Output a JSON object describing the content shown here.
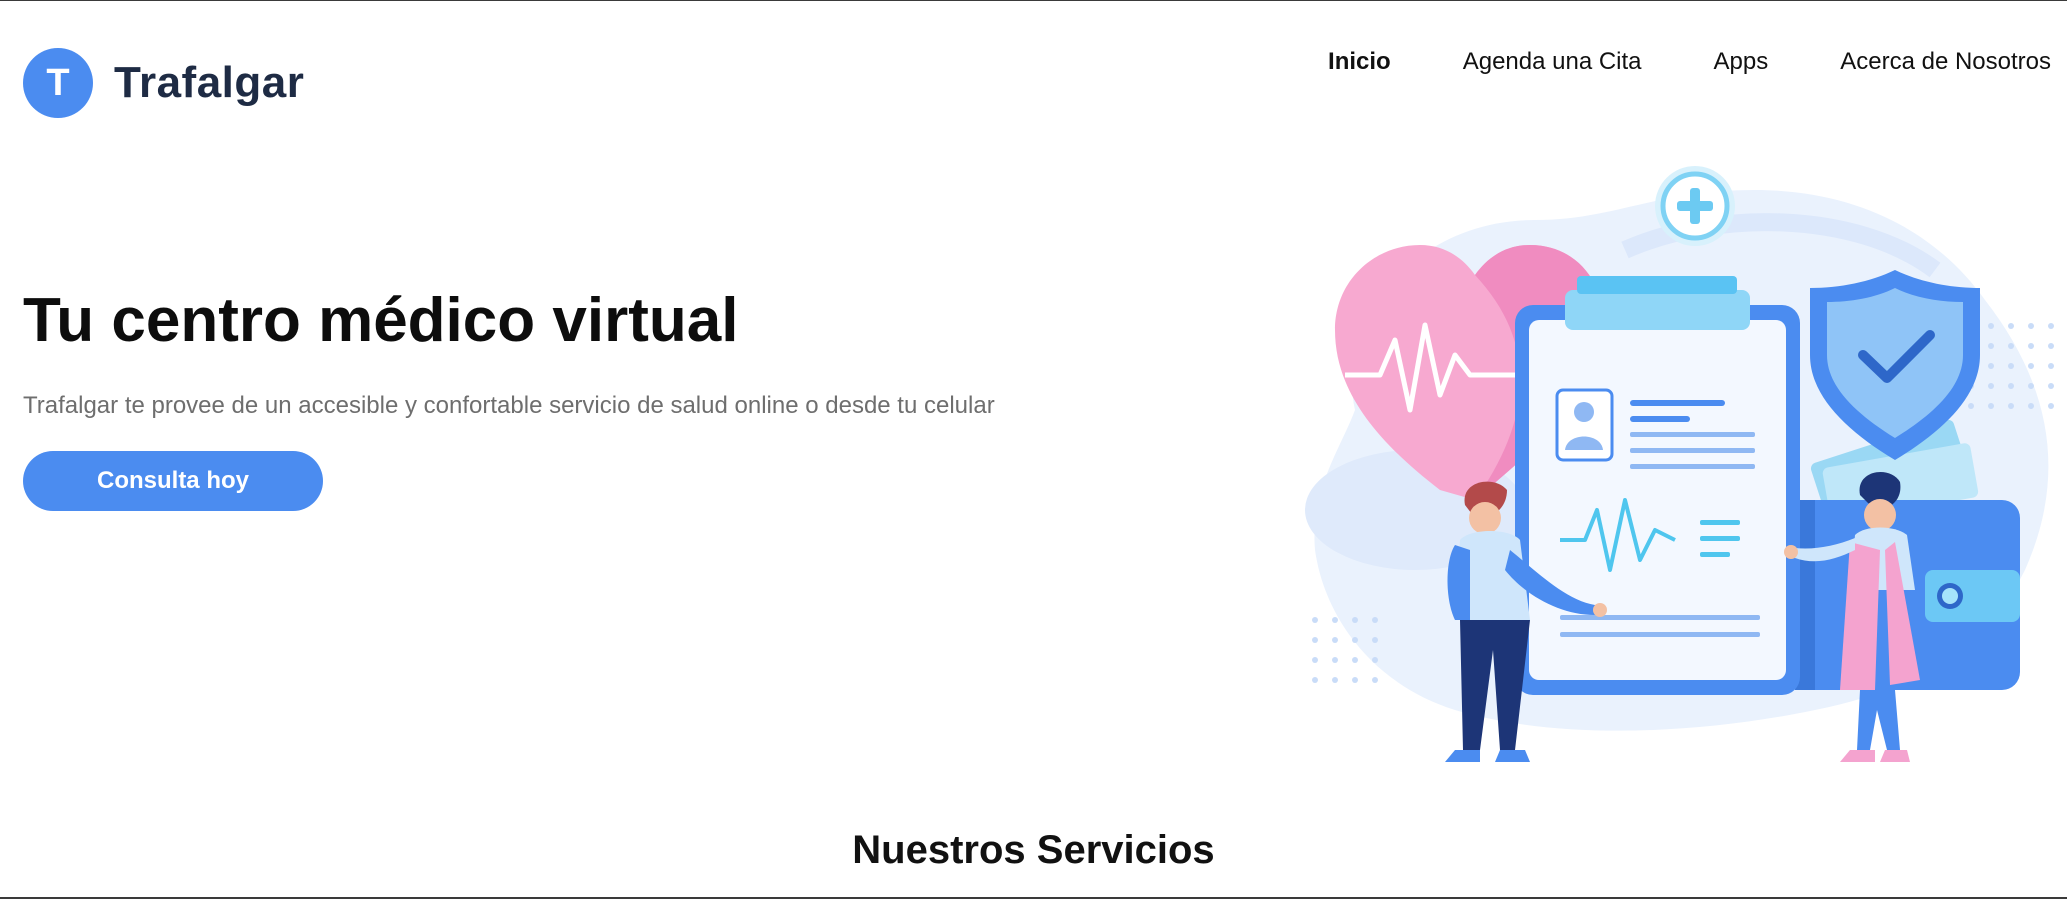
{
  "brand": {
    "logo_letter": "T",
    "name": "Trafalgar"
  },
  "nav": {
    "items": [
      {
        "label": "Inicio",
        "active": true
      },
      {
        "label": "Agenda una Cita",
        "active": false
      },
      {
        "label": "Apps",
        "active": false
      },
      {
        "label": "Acerca de Nosotros",
        "active": false
      }
    ]
  },
  "hero": {
    "title": "Tu centro médico virtual",
    "subtitle": "Trafalgar te provee de un accesible y confortable servicio de salud online o desde tu celular",
    "cta_label": "Consulta hoy"
  },
  "services": {
    "title": "Nuestros Servicios"
  },
  "colors": {
    "accent": "#4b8cf0",
    "brand_text": "#1e2b44",
    "subtitle": "#6e6e6e"
  },
  "icons": [
    "heart-icon",
    "clipboard-icon",
    "shield-check-icon",
    "plus-circle-icon",
    "wallet-icon"
  ]
}
